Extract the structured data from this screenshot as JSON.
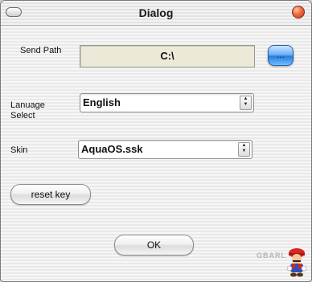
{
  "window": {
    "title": "Dialog"
  },
  "send_path": {
    "label": "Send Path",
    "value": "C:\\",
    "browse_label": "..."
  },
  "language": {
    "label_line1": "Lanuage",
    "label_line2": "Select",
    "selected": "English"
  },
  "skin": {
    "label": "Skin",
    "selected": "AquaOS.ssk"
  },
  "buttons": {
    "reset_label": "reset key",
    "ok_label": "OK"
  },
  "watermark": "GBARL",
  "icons": {
    "minimize": "pill-minimize-icon",
    "close": "close-icon",
    "dropdown": "updown-arrow-icon"
  },
  "colors": {
    "browse_accent": "#2b7ce0",
    "close_accent": "#f06a3f"
  }
}
